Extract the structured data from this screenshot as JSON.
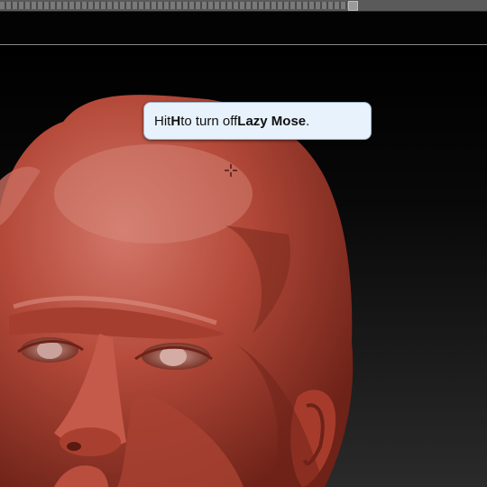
{
  "app": {
    "top_slider": {
      "value_percent": 73
    }
  },
  "tooltip": {
    "prefix": "Hit ",
    "key": "H",
    "middle": " to turn off ",
    "feature": "Lazy Mose",
    "suffix": "."
  },
  "viewport": {
    "subject": "sculpted-head",
    "colors": {
      "clay": "#b54a3a",
      "clay_shadow": "#6e2218",
      "background_top": "#000000",
      "background_bottom": "#2a2a2a",
      "tooltip_bg": "#e7f2fc"
    }
  },
  "cursor": {
    "icon": "crosshair-cursor-icon"
  }
}
